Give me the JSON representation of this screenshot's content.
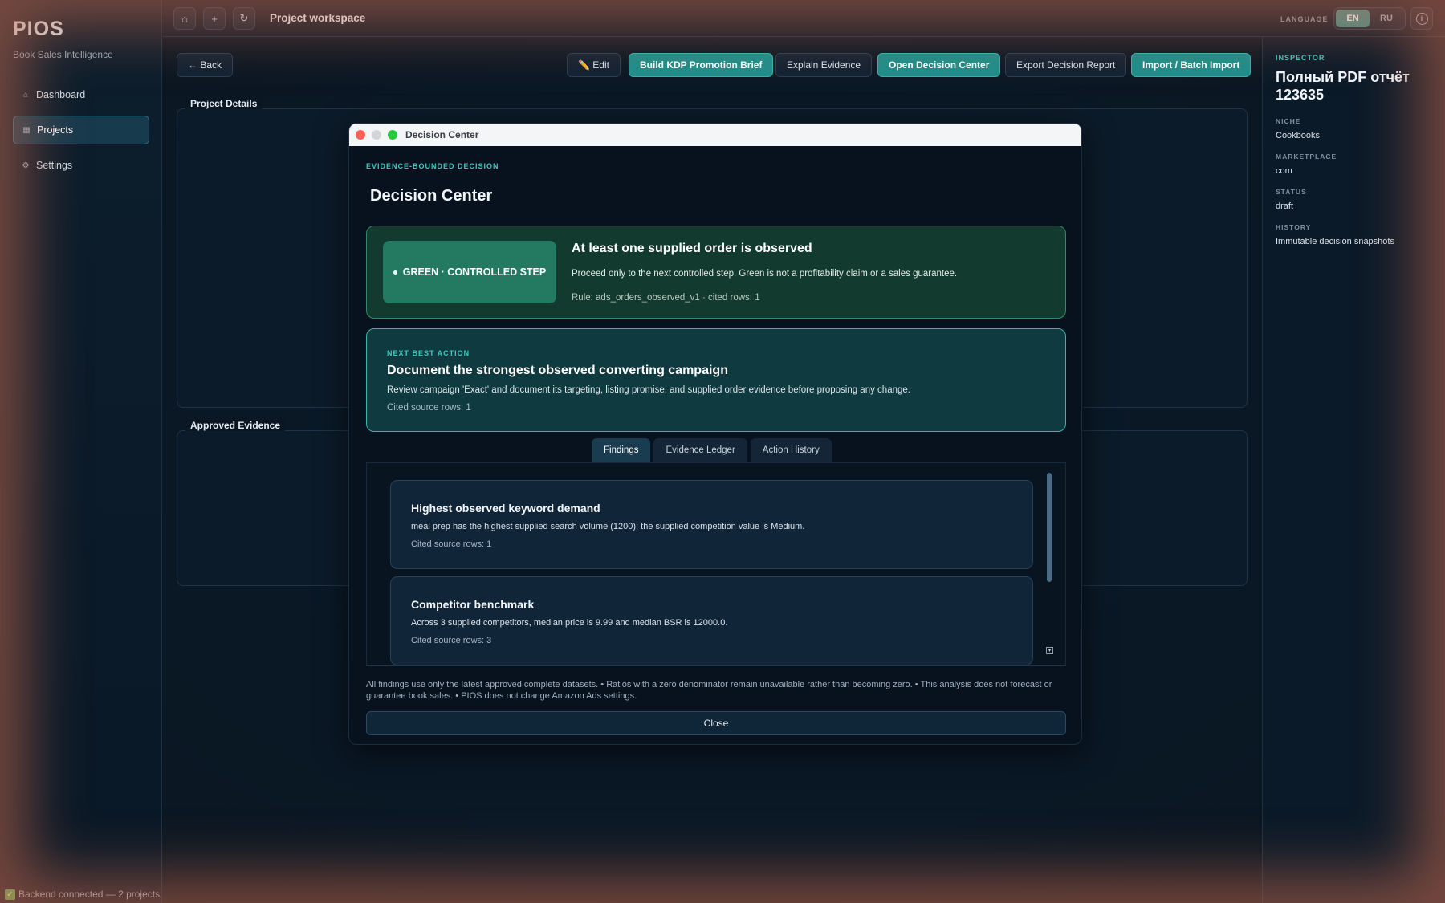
{
  "sidebar": {
    "brand": "PIOS",
    "subtitle": "Book Sales Intelligence",
    "items": [
      {
        "label": "Dashboard",
        "icon": "home-icon"
      },
      {
        "label": "Projects",
        "icon": "grid-icon"
      },
      {
        "label": "Settings",
        "icon": "gear-icon"
      }
    ],
    "status": "Backend connected — 2 projects"
  },
  "topbar": {
    "title": "Project workspace",
    "language_label": "LANGUAGE",
    "lang_en": "EN",
    "lang_ru": "RU"
  },
  "toolbar": {
    "back": "← Back",
    "edit": "✏️ Edit",
    "build_brief": "Build KDP Promotion Brief",
    "explain": "Explain Evidence",
    "open_decision": "Open Decision Center",
    "export": "Export Decision Report",
    "import": "Import / Batch Import"
  },
  "sections": {
    "project_details": "Project Details",
    "approved_evidence": "Approved Evidence"
  },
  "inspector": {
    "heading": "INSPECTOR",
    "title": "Полный PDF отчёт 123635",
    "niche_label": "NICHE",
    "niche": "Cookbooks",
    "marketplace_label": "MARKETPLACE",
    "marketplace": "com",
    "status_label": "STATUS",
    "status": "draft",
    "history_label": "HISTORY",
    "history": "Immutable decision snapshots"
  },
  "modal": {
    "window_title": "Decision Center",
    "eyebrow": "EVIDENCE-BOUNDED DECISION",
    "heading": "Decision Center",
    "verdict": {
      "badge": "GREEN · CONTROLLED STEP",
      "title": "At least one supplied order is observed",
      "text": "Proceed only to the next controlled step. Green is not a profitability claim or a sales guarantee.",
      "rule": "Rule: ads_orders_observed_v1 · cited rows: 1"
    },
    "next_action": {
      "eyebrow": "NEXT BEST ACTION",
      "title": "Document the strongest observed converting campaign",
      "text": "Review campaign 'Exact' and document its targeting, listing promise, and supplied order evidence before proposing any change.",
      "cite": "Cited source rows: 1"
    },
    "tabs": [
      "Findings",
      "Evidence Ledger",
      "Action History"
    ],
    "findings": [
      {
        "title": "Highest observed keyword demand",
        "text": "meal prep has the highest supplied search volume (1200); the supplied competition value is Medium.",
        "cite": "Cited source rows: 1"
      },
      {
        "title": "Competitor benchmark",
        "text": "Across 3 supplied competitors, median price is 9.99 and median BSR is 12000.0.",
        "cite": "Cited source rows: 3"
      }
    ],
    "disclaimer": "All findings use only the latest approved complete datasets.  •  Ratios with a zero denominator remain unavailable rather than becoming zero.  •  This analysis does not forecast or guarantee book sales.  •  PIOS does not change Amazon Ads settings.",
    "close": "Close"
  }
}
